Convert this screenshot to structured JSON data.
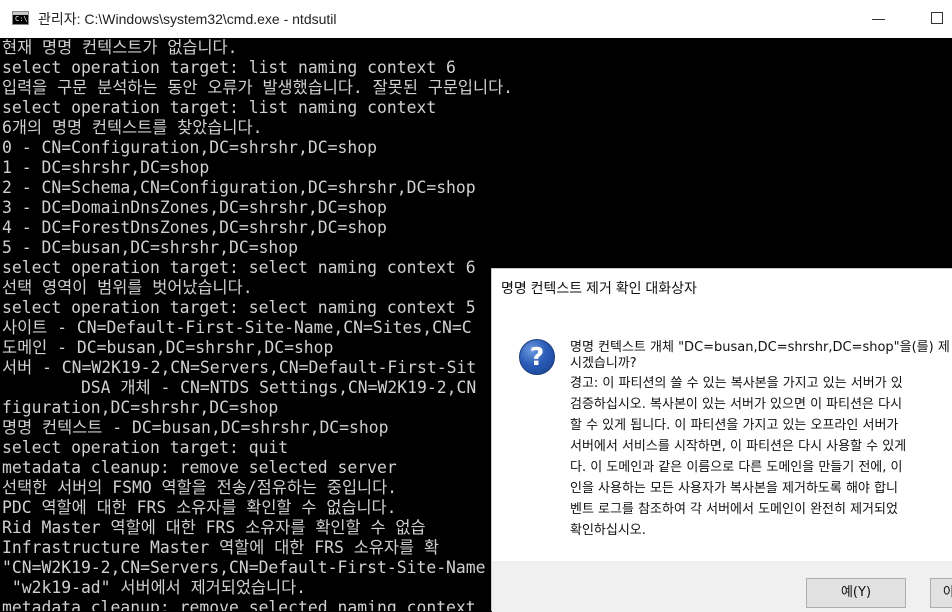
{
  "window": {
    "title": "관리자: C:\\Windows\\system32\\cmd.exe - ntdsutil",
    "icon": "cmd-icon",
    "icon_text": "C:\\"
  },
  "console": {
    "text_color": "#d0d0d0",
    "background": "#000000",
    "lines": [
      "현재 명명 컨텍스트가 없습니다.",
      "select operation target: list naming context 6",
      "입력을 구문 분석하는 동안 오류가 발생했습니다. 잘못된 구문입니다.",
      "select operation target: list naming context",
      "6개의 명명 컨텍스트를 찾았습니다.",
      "0 - CN=Configuration,DC=shrshr,DC=shop",
      "1 - DC=shrshr,DC=shop",
      "2 - CN=Schema,CN=Configuration,DC=shrshr,DC=shop",
      "3 - DC=DomainDnsZones,DC=shrshr,DC=shop",
      "4 - DC=ForestDnsZones,DC=shrshr,DC=shop",
      "5 - DC=busan,DC=shrshr,DC=shop",
      "select operation target: select naming context 6",
      "선택 영역이 범위를 벗어났습니다.",
      "select operation target: select naming context 5",
      "사이트 - CN=Default-First-Site-Name,CN=Sites,CN=C",
      "도메인 - DC=busan,DC=shrshr,DC=shop",
      "서버 - CN=W2K19-2,CN=Servers,CN=Default-First-Sit",
      "        DSA 개체 - CN=NTDS Settings,CN=W2K19-2,CN",
      "figuration,DC=shrshr,DC=shop",
      "명명 컨텍스트 - DC=busan,DC=shrshr,DC=shop",
      "select operation target: quit",
      "metadata cleanup: remove selected server",
      "선택한 서버의 FSMO 역할을 전송/점유하는 중입니다.",
      "PDC 역할에 대한 FRS 소유자를 확인할 수 없습니다.",
      "Rid Master 역할에 대한 FRS 소유자를 확인할 수 없습",
      "Infrastructure Master 역할에 대한 FRS 소유자를 확",
      "\"CN=W2K19-2,CN=Servers,CN=Default-First-Site-Name",
      " \"w2k19-ad\" 서버에서 제거되었습니다.",
      "metadata cleanup: remove selected naming context"
    ]
  },
  "dialog": {
    "title": "명명 컨텍스트 제거 확인 대화상자",
    "icon": "question-icon",
    "icon_glyph": "?",
    "message_lines": [
      "명명 컨텍스트 개체 \"DC=busan,DC=shrshr,DC=shop\"을(를) 제",
      "시겠습니까?",
      "경고: 이 파티션의 쓸 수 있는 복사본을 가지고 있는 서버가 있",
      "검증하십시오. 복사본이 있는 서버가 있으면 이 파티션은 다시",
      "할 수 있게 됩니다. 이 파티션을 가지고 있는 오프라인 서버가",
      "서버에서 서비스를 시작하면, 이 파티션은 다시 사용할 수 있게",
      "다. 이 도메인과 같은 이름으로 다른 도메인을 만들기 전에, 이",
      "인을 사용하는 모든 사용자가 복사본을 제거하도록 해야 합니",
      "벤트 로그를 참조하여 각 서버에서 도메인이 완전히 제거되었",
      "확인하십시오."
    ],
    "yes_label": "예(Y)",
    "no_label": "아니"
  }
}
